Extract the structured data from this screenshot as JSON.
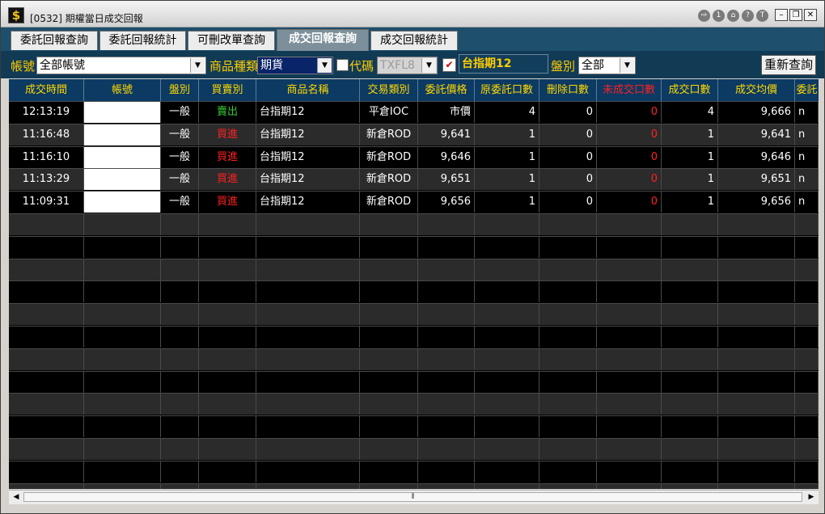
{
  "window": {
    "title": "[0532] 期權當日成交回報"
  },
  "title_buttons": [
    "⇨",
    "1",
    "⌂",
    "?",
    "T"
  ],
  "window_controls": {
    "minimize": "–",
    "restore": "❐",
    "close": "✕"
  },
  "tabs": [
    {
      "label": "委託回報查詢",
      "active": false
    },
    {
      "label": "委託回報統計",
      "active": false
    },
    {
      "label": "可刪改單查詢",
      "active": false
    },
    {
      "label": "成交回報查詢",
      "active": true
    },
    {
      "label": "成交回報統計",
      "active": false
    }
  ],
  "filters": {
    "account_label": "帳號",
    "account_value": "全部帳號",
    "product_type_label": "商品種類",
    "product_type_value": "期貨",
    "code_label": "代碼",
    "code_value": "TXFL8",
    "product_name": "台指期12",
    "session_label": "盤別",
    "session_value": "全部",
    "requery_button": "重新查詢"
  },
  "table": {
    "headers": [
      "成交時間",
      "帳號",
      "盤別",
      "買賣別",
      "商品名稱",
      "交易類別",
      "委託價格",
      "原委託口數",
      "刪除口數",
      "未成交口數",
      "成交口數",
      "成交均價",
      "委託"
    ],
    "header_accents": {
      "unfilled": "#ff2020",
      "default": "#ffd800"
    },
    "rows": [
      {
        "time": "12:13:19",
        "account": "",
        "session": "一般",
        "side": "賣出",
        "product": "台指期12",
        "trade_type": "平倉IOC",
        "price": "市價",
        "orig_qty": "4",
        "cancel_qty": "0",
        "unfilled_qty": "0",
        "filled_qty": "4",
        "avg_price": "9,666",
        "order": "n"
      },
      {
        "time": "11:16:48",
        "account": "",
        "session": "一般",
        "side": "買進",
        "product": "台指期12",
        "trade_type": "新倉ROD",
        "price": "9,641",
        "orig_qty": "1",
        "cancel_qty": "0",
        "unfilled_qty": "0",
        "filled_qty": "1",
        "avg_price": "9,641",
        "order": "n"
      },
      {
        "time": "11:16:10",
        "account": "",
        "session": "一般",
        "side": "買進",
        "product": "台指期12",
        "trade_type": "新倉ROD",
        "price": "9,646",
        "orig_qty": "1",
        "cancel_qty": "0",
        "unfilled_qty": "0",
        "filled_qty": "1",
        "avg_price": "9,646",
        "order": "n"
      },
      {
        "time": "11:13:29",
        "account": "",
        "session": "一般",
        "side": "買進",
        "product": "台指期12",
        "trade_type": "新倉ROD",
        "price": "9,651",
        "orig_qty": "1",
        "cancel_qty": "0",
        "unfilled_qty": "0",
        "filled_qty": "1",
        "avg_price": "9,651",
        "order": "n"
      },
      {
        "time": "11:09:31",
        "account": "",
        "session": "一般",
        "side": "買進",
        "product": "台指期12",
        "trade_type": "新倉ROD",
        "price": "9,656",
        "orig_qty": "1",
        "cancel_qty": "0",
        "unfilled_qty": "0",
        "filled_qty": "1",
        "avg_price": "9,656",
        "order": "n"
      }
    ]
  },
  "colors": {
    "sell": "#33cc33",
    "buy": "#ff2020",
    "unfilled": "#ff2020",
    "header_text": "#ffd800",
    "product_text": "#ffcc00"
  },
  "scrollbar": {
    "left": "◀",
    "right": "▶",
    "grip": "⦀"
  }
}
